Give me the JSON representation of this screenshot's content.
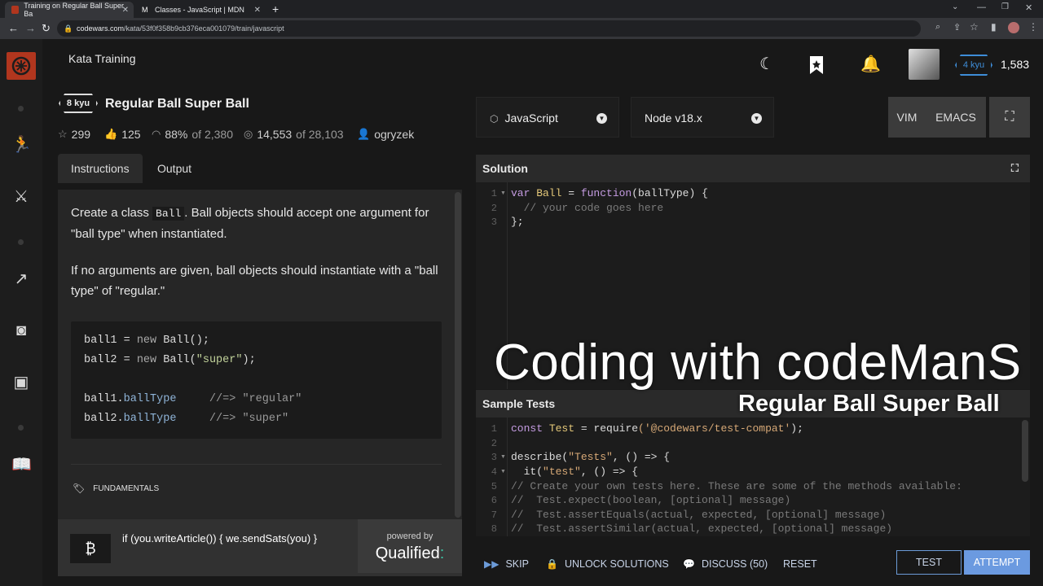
{
  "browser": {
    "tabs": [
      {
        "title": "Training on Regular Ball Super Ba",
        "active": true
      },
      {
        "title": "Classes - JavaScript | MDN",
        "active": false
      }
    ],
    "url_domain": "codewars.com",
    "url_path": "/kata/53f0f358b9cb376eca001079/train/javascript"
  },
  "header": {
    "section_title": "Kata Training",
    "rank": "4 kyu",
    "honor": "1,583"
  },
  "kata": {
    "kyu": "8 kyu",
    "title": "Regular Ball Super Ball",
    "stars": "299",
    "votes": "125",
    "satisfaction": "88%",
    "satisfaction_of": "of 2,380",
    "completed": "14,553",
    "completed_of": "of 28,103",
    "author": "ogryzek"
  },
  "tabs": {
    "instructions": "Instructions",
    "output": "Output"
  },
  "instructions": {
    "p1_a": "Create a class ",
    "p1_code": "Ball",
    "p1_b": ". Ball objects should accept one argument for \"ball type\" when instantiated.",
    "p2": "If no arguments are given, ball objects should instantiate with a \"ball type\" of \"regular.\"",
    "code": {
      "l1_var": "ball1",
      "l1_op": " = ",
      "l1_new": "new",
      "l1_rest": " Ball();",
      "l2_var": "ball2",
      "l2_op": " = ",
      "l2_new": "new",
      "l2_rest": " Ball(",
      "l2_str": "\"super\"",
      "l2_end": ");",
      "l4_obj": "ball1.",
      "l4_prop": "ballType",
      "l4_cm": "     //=> ",
      "l4_str": "\"regular\"",
      "l5_obj": "ball2.",
      "l5_prop": "ballType",
      "l5_cm": "     //=> ",
      "l5_str": "\"super\""
    },
    "tag": "FUNDAMENTALS"
  },
  "ad": {
    "text": "if (you.writeArticle()) { we.sendSats(you) }",
    "powered": "powered by",
    "brand": "Qualified"
  },
  "editor": {
    "language": "JavaScript",
    "runtime": "Node v18.x",
    "vim": "VIM",
    "emacs": "EMACS",
    "solution_label": "Solution",
    "solution_lines": {
      "n1": "1",
      "n2": "2",
      "n3": "3",
      "l1_kw": "var",
      "l1_name": " Ball",
      "l1_eq": " = ",
      "l1_fn": "function",
      "l1_arg": "(ballType) {",
      "l2": "  // your code goes here",
      "l3": "};"
    },
    "tests_label": "Sample Tests",
    "test_lines": {
      "n1": "1",
      "n2": "2",
      "n3": "3",
      "n4": "4",
      "n5": "5",
      "n6": "6",
      "n7": "7",
      "n8": "8",
      "l1_kw": "const",
      "l1_name": " Test",
      "l1_eq": " = ",
      "l1_fn": "require",
      "l1_str": "('@codewars/test-compat'",
      "l1_end": ");",
      "l3_a": "describe(",
      "l3_str": "\"Tests\"",
      "l3_b": ", () => {",
      "l4_a": "  it(",
      "l4_str": "\"test\"",
      "l4_b": ", () => {",
      "l5": "// Create your own tests here. These are some of the methods available:",
      "l6": "//  Test.expect(boolean, [optional] message)",
      "l7": "//  Test.assertEquals(actual, expected, [optional] message)",
      "l8": "//  Test.assertSimilar(actual, expected, [optional] message)"
    }
  },
  "overlay": {
    "title": "Coding with codeManS",
    "subtitle": "Regular Ball Super Ball"
  },
  "actions": {
    "skip": "SKIP",
    "unlock": "UNLOCK SOLUTIONS",
    "discuss": "DISCUSS (50)",
    "reset": "RESET",
    "test": "TEST",
    "attempt": "ATTEMPT"
  },
  "colors": {
    "brand_red": "#b1361e",
    "accent_blue": "#6b9ae0",
    "rank_blue": "#3e8dd8"
  }
}
